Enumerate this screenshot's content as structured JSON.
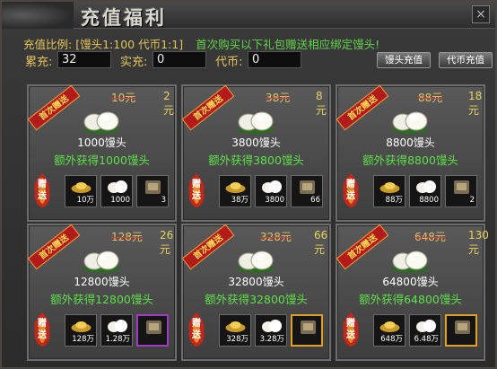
{
  "window": {
    "title": "充值福利",
    "close_glyph": "×"
  },
  "info": {
    "ratio_label": "充值比例:",
    "ratio_value": "[馒头1:100 代币1:1]",
    "promo": "首次购买以下礼包赠送相应绑定馒头!"
  },
  "stats": {
    "total_label": "累充:",
    "total_value": "32",
    "real_label": "实充:",
    "real_value": "0",
    "token_label": "代币:",
    "token_value": "0"
  },
  "buttons": {
    "mantou_recharge": "馒头充值",
    "token_recharge": "代币充值"
  },
  "ribbon_text": "首次赠送",
  "gift_text": "赠送",
  "packs": [
    {
      "old_price": "10元",
      "price": "2元",
      "amount": "1000馒头",
      "extra": "额外获得1000馒头",
      "items": [
        "10万",
        "1000",
        "3"
      ]
    },
    {
      "old_price": "38元",
      "price": "8元",
      "amount": "3800馒头",
      "extra": "额外获得3800馒头",
      "items": [
        "38万",
        "3800",
        "66"
      ]
    },
    {
      "old_price": "88元",
      "price": "18元",
      "amount": "8800馒头",
      "extra": "额外获得8800馒头",
      "items": [
        "88万",
        "8800",
        "2"
      ]
    },
    {
      "old_price": "128元",
      "price": "26元",
      "amount": "12800馒头",
      "extra": "额外获得12800馒头",
      "items": [
        "128万",
        "1.28万",
        ""
      ]
    },
    {
      "old_price": "328元",
      "price": "66元",
      "amount": "32800馒头",
      "extra": "额外获得32800馒头",
      "items": [
        "328万",
        "3.28万",
        ""
      ]
    },
    {
      "old_price": "648元",
      "price": "130元",
      "amount": "64800馒头",
      "extra": "额外获得64800馒头",
      "items": [
        "648万",
        "6.48万",
        ""
      ]
    }
  ],
  "item_icons": [
    "gold-ingot-icon",
    "mantou-bun-icon",
    "reward-item-icon"
  ],
  "colors": {
    "accent_gold": "#e3c35a",
    "promo_green": "#62d34a",
    "ribbon_red": "#b31a1a"
  }
}
